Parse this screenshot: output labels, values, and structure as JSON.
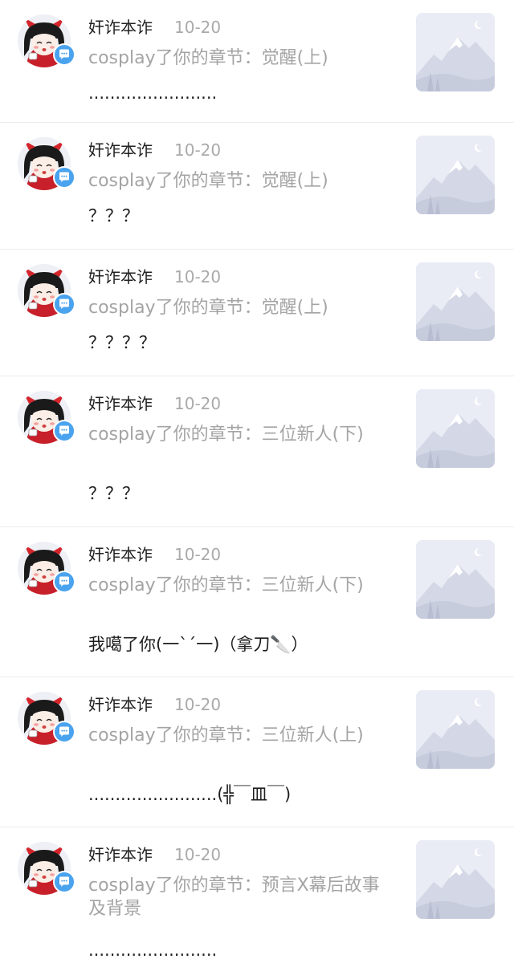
{
  "notifications": [
    {
      "user": "奸诈本诈",
      "date": "10-20",
      "action": "cosplay了你的章节：觉醒(上)",
      "comment": "........................",
      "avatar_icon": "devil-girl-avatar-icon",
      "badge_icon": "comment-bubble-icon",
      "thumb_icon": "mountain-placeholder-icon"
    },
    {
      "user": "奸诈本诈",
      "date": "10-20",
      "action": "cosplay了你的章节：觉醒(上)",
      "comment": "？？？",
      "avatar_icon": "devil-girl-avatar-icon",
      "badge_icon": "comment-bubble-icon",
      "thumb_icon": "mountain-placeholder-icon"
    },
    {
      "user": "奸诈本诈",
      "date": "10-20",
      "action": "cosplay了你的章节：觉醒(上)",
      "comment": "？？？？",
      "avatar_icon": "devil-girl-avatar-icon",
      "badge_icon": "comment-bubble-icon",
      "thumb_icon": "mountain-placeholder-icon"
    },
    {
      "user": "奸诈本诈",
      "date": "10-20",
      "action": "cosplay了你的章节：三位新人(下)",
      "comment": "？？？",
      "avatar_icon": "devil-girl-avatar-icon",
      "badge_icon": "comment-bubble-icon",
      "thumb_icon": "mountain-placeholder-icon"
    },
    {
      "user": "奸诈本诈",
      "date": "10-20",
      "action": "cosplay了你的章节：三位新人(下)",
      "comment": "我噶了你(一`´一)（拿刀🔪）",
      "avatar_icon": "devil-girl-avatar-icon",
      "badge_icon": "comment-bubble-icon",
      "thumb_icon": "mountain-placeholder-icon"
    },
    {
      "user": "奸诈本诈",
      "date": "10-20",
      "action": "cosplay了你的章节：三位新人(上)",
      "comment": "........................(╬￣皿￣)",
      "avatar_icon": "devil-girl-avatar-icon",
      "badge_icon": "comment-bubble-icon",
      "thumb_icon": "mountain-placeholder-icon"
    },
    {
      "user": "奸诈本诈",
      "date": "10-20",
      "action": "cosplay了你的章节：预言X幕后故事及背景",
      "comment": "........................",
      "avatar_icon": "devil-girl-avatar-icon",
      "badge_icon": "comment-bubble-icon",
      "thumb_icon": "mountain-placeholder-icon"
    }
  ],
  "colors": {
    "username": "#222222",
    "meta": "#aaaaaa",
    "action": "#a4a4a4",
    "comment": "#1e1e1e",
    "badge": "#4aa3ee",
    "divider": "#ececec",
    "thumb_bg": "#e9ecf5"
  }
}
